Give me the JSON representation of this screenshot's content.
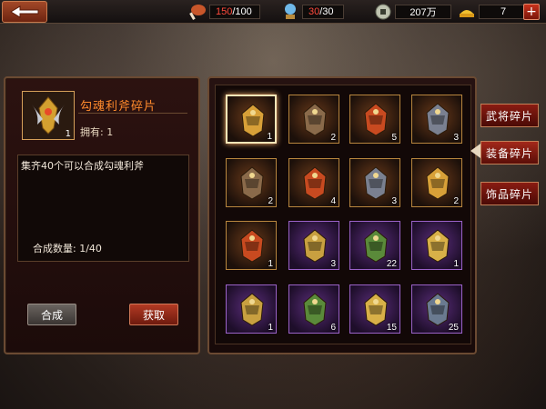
{
  "topbar": {
    "back_label": "back-arrow-icon",
    "stamina": {
      "current": "150",
      "max": "/100",
      "icon": "meat-icon"
    },
    "energy": {
      "current": "30",
      "max": "/30",
      "icon": "crystal-ball-icon"
    },
    "coins": {
      "value": "207万",
      "icon": "coin-icon"
    },
    "gold": {
      "value": "7",
      "icon": "gold-ingot-icon"
    },
    "add_label": "+"
  },
  "detail": {
    "name": "勾魂利斧碎片",
    "thumb_qty": "1",
    "owned": "拥有: 1",
    "description": "集齐40个可以合成勾魂利斧",
    "combine_count": "合成数量:  1/40",
    "combine_button": "合成",
    "obtain_button": "获取"
  },
  "grid": {
    "items": [
      {
        "qty": "1",
        "rarity": "orange",
        "icon": "axe-icon"
      },
      {
        "qty": "2",
        "rarity": "orange",
        "icon": "armor-icon"
      },
      {
        "qty": "5",
        "rarity": "orange",
        "icon": "flame-sword-icon"
      },
      {
        "qty": "3",
        "rarity": "orange",
        "icon": "helmet-icon"
      },
      {
        "qty": "2",
        "rarity": "orange",
        "icon": "chest-armor-icon"
      },
      {
        "qty": "4",
        "rarity": "orange",
        "icon": "gold-armor-icon"
      },
      {
        "qty": "3",
        "rarity": "orange",
        "icon": "crescent-blade-icon"
      },
      {
        "qty": "2",
        "rarity": "orange",
        "icon": "treasure-icon"
      },
      {
        "qty": "1",
        "rarity": "orange",
        "icon": "pagoda-icon"
      },
      {
        "qty": "3",
        "rarity": "purple",
        "icon": "dragon-statue-icon"
      },
      {
        "qty": "22",
        "rarity": "purple",
        "icon": "mask-armor-icon"
      },
      {
        "qty": "1",
        "rarity": "purple",
        "icon": "warrior-armor-icon"
      },
      {
        "qty": "1",
        "rarity": "purple",
        "icon": "beast-icon"
      },
      {
        "qty": "6",
        "rarity": "purple",
        "icon": "golden-beast-icon"
      },
      {
        "qty": "15",
        "rarity": "purple",
        "icon": "skull-armor-icon"
      },
      {
        "qty": "25",
        "rarity": "purple",
        "icon": "mace-icon"
      }
    ]
  },
  "tabs": [
    {
      "label": "武将碎片"
    },
    {
      "label": "装备碎片"
    },
    {
      "label": "饰品碎片"
    }
  ]
}
